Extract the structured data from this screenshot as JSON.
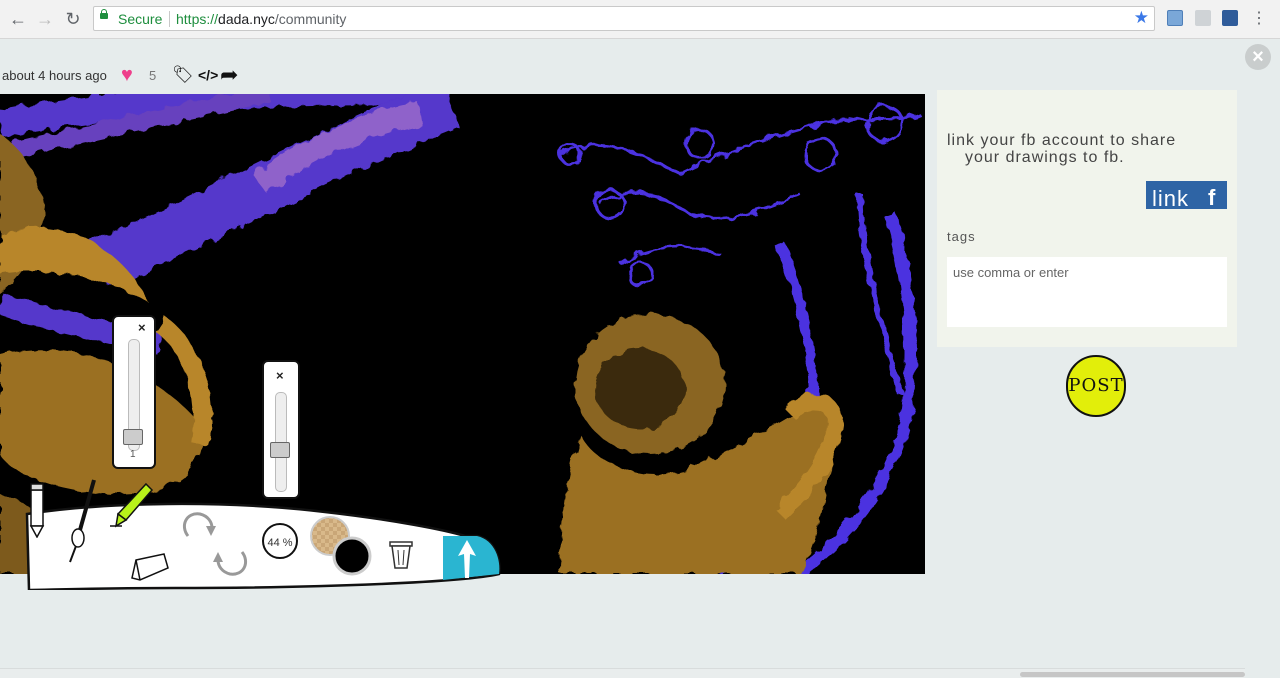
{
  "browser": {
    "secure_label": "Secure",
    "url_scheme": "https://",
    "url_host": "dada.nyc",
    "url_path": "/community",
    "back_icon": "arrow-left-icon",
    "forward_icon": "arrow-right-icon",
    "reload_icon": "reload-icon",
    "bookmark_icon": "star-icon",
    "menu_icon": "kebab-menu-icon"
  },
  "post_meta": {
    "timestamp": "about 4 hours ago",
    "likes": "5"
  },
  "side_panel": {
    "fb_text_line1": "link your fb account to share",
    "fb_text_line2": "your drawings to fb.",
    "link_button_label": "link",
    "fb_glyph": "f",
    "tags_label": "tags",
    "tags_placeholder": "use comma or enter",
    "post_button_label": "POST"
  },
  "toolbar": {
    "brush_size_value": "1",
    "opacity_percent": "44 %",
    "opacity_slider_close": "×",
    "size_slider_close": "×",
    "primary_color": "#000000",
    "accent_color": "#2ab5d1"
  },
  "colors": {
    "page_bg": "#e6ecec",
    "panel_bg": "#f1f4ec",
    "fb_blue": "#2e64a5",
    "post_yellow": "#e2ee0a",
    "heart_pink": "#ee3f8b",
    "drawing_orange": "#b8862a",
    "drawing_purple": "#5a3ad6"
  }
}
